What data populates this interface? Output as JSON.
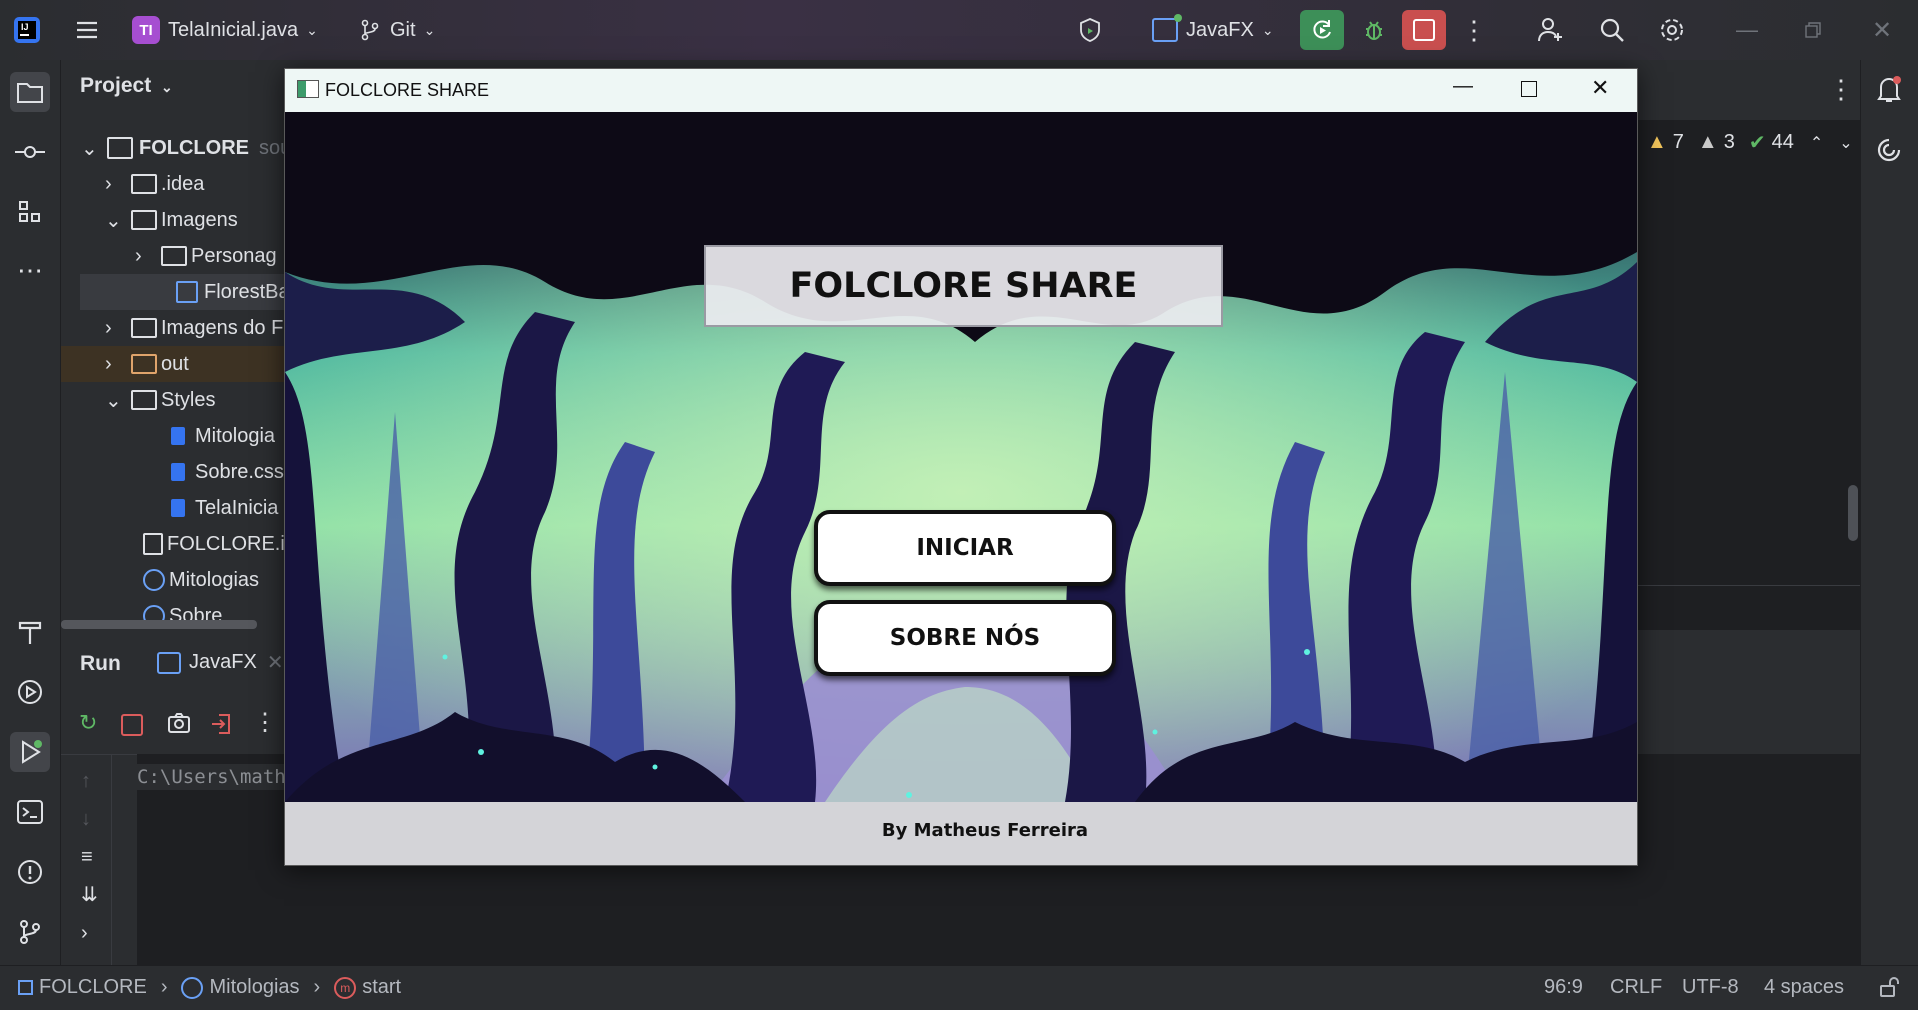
{
  "ide": {
    "project_badge": "TI",
    "project_file": "TelaInicial.java",
    "vcs": "Git",
    "run_config": "JavaFX",
    "colors": {
      "accent_green": "#3d8f58",
      "stop_red": "#c94f4f",
      "badge_purple": "#a64ed1"
    }
  },
  "project_panel": {
    "title": "Project",
    "items": [
      {
        "label": "FOLCLORE",
        "suffix": "sou"
      },
      {
        "label": ".idea"
      },
      {
        "label": "Imagens"
      },
      {
        "label": "Personag"
      },
      {
        "label": "FlorestBa"
      },
      {
        "label": "Imagens do F"
      },
      {
        "label": "out"
      },
      {
        "label": "Styles"
      },
      {
        "label": "Mitologia"
      },
      {
        "label": "Sobre.css"
      },
      {
        "label": "TelaInicia"
      },
      {
        "label": "FOLCLORE.in"
      },
      {
        "label": "Mitologias"
      },
      {
        "label": "Sobre"
      }
    ]
  },
  "editor": {
    "warnings": "7",
    "weak_warnings": "3",
    "checks": "44"
  },
  "run_panel": {
    "title": "Run",
    "tab": "JavaFX",
    "console_line": "C:\\Users\\math"
  },
  "statusbar": {
    "project": "FOLCLORE",
    "class": "Mitologias",
    "method": "start",
    "position": "96:9",
    "line_sep": "CRLF",
    "encoding": "UTF-8",
    "indent": "4 spaces"
  },
  "fx_app": {
    "window_title": "FOLCLORE SHARE",
    "header": "FOLCLORE SHARE",
    "start_button": "INICIAR",
    "about_button": "SOBRE NÓS",
    "footer": "By Matheus Ferreira"
  }
}
